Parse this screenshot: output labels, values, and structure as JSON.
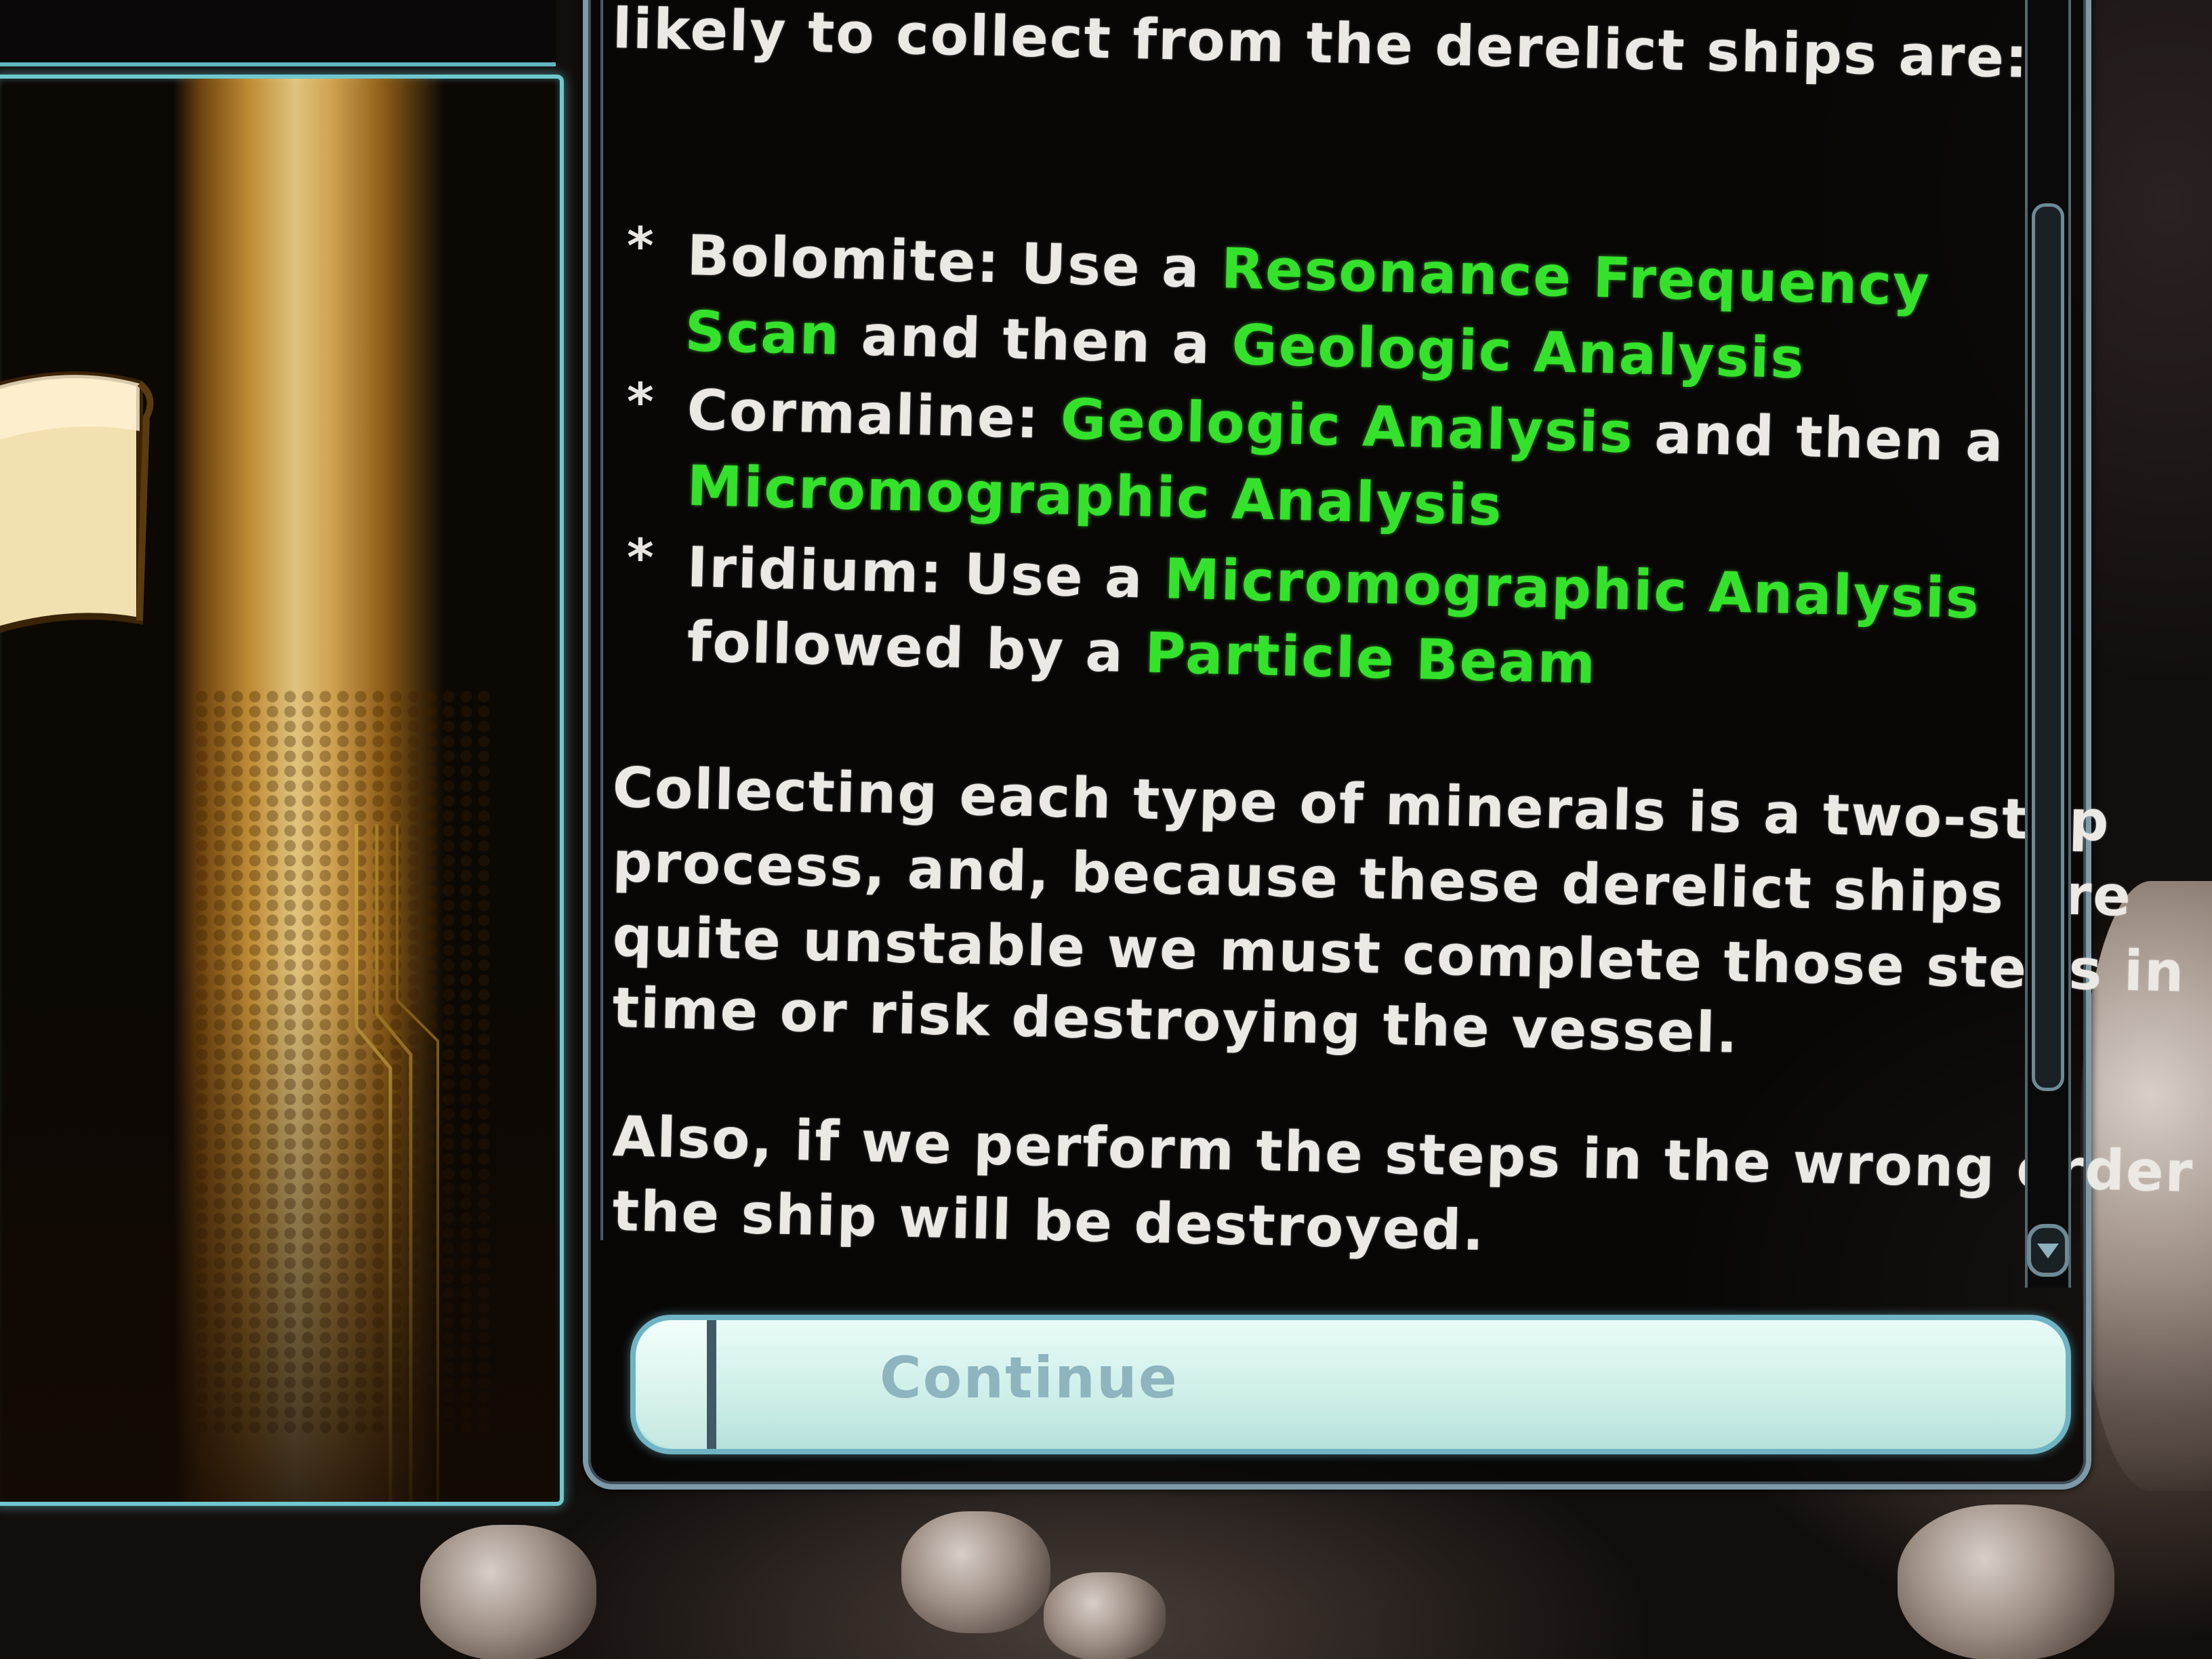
{
  "dialog": {
    "partial_top_line": "likely to collect from the derelict ships are:",
    "minerals": [
      {
        "line1_prefix": "Bolomite: Use a ",
        "line1_highlight": "Resonance Frequency",
        "line2_highlight": "Scan",
        "line2_middle": " and then a ",
        "line2_highlight2": "Geologic Analysis"
      },
      {
        "line1_prefix": "Cormaline: ",
        "line1_highlight": "Geologic Analysis",
        "line1_suffix": " and then a",
        "line2_highlight": "Micromographic Analysis"
      },
      {
        "line1_prefix": "Iridium: Use a ",
        "line1_highlight": "Micromographic Analysis",
        "line2_prefix": "followed by a ",
        "line2_highlight": "Particle Beam"
      }
    ],
    "bullet_symbol": "*",
    "paragraph1": [
      "Collecting each type of minerals is a two-step",
      "process, and, because these derelict ships are",
      "quite unstable we must complete those steps in",
      "time or risk destroying the vessel."
    ],
    "paragraph2": [
      "Also, if we perform the steps in the wrong order",
      "the ship will be destroyed."
    ]
  },
  "continue_button": {
    "label": "Continue"
  },
  "colors": {
    "highlight_green": "#34e22c",
    "body_text": "#ece8e4",
    "frame_cyan": "#6fc8d0",
    "button_face": "#d6f3ee",
    "button_label": "#8db4bf"
  },
  "icons": [
    "scroll-icon",
    "scroll-down-arrow-icon"
  ]
}
